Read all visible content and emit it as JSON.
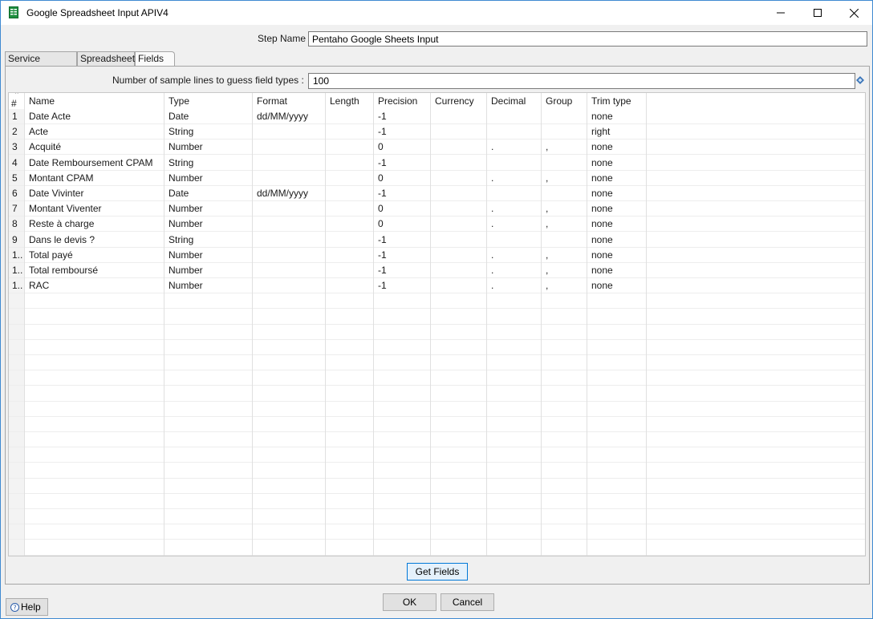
{
  "window": {
    "title": "Google Spreadsheet Input APIV4",
    "app_icon": "spreadsheet-icon",
    "controls": [
      "minimize-icon",
      "maximize-icon",
      "close-icon"
    ]
  },
  "step": {
    "label": "Step Name",
    "value": "Pentaho Google Sheets Input"
  },
  "tabs": [
    {
      "label": "Service Account"
    },
    {
      "label": "Spreadsheet"
    },
    {
      "label": "Fields",
      "active": true
    }
  ],
  "fields_tab": {
    "sample_label": "Number of sample lines to guess field types :",
    "sample_value": "100",
    "variable_icon": "variable-diamond-icon"
  },
  "grid": {
    "columns": [
      "#",
      "Name",
      "Type",
      "Format",
      "Length",
      "Precision",
      "Currency",
      "Decimal",
      "Group",
      "Trim type"
    ],
    "rows": [
      {
        "num": "1",
        "name": "Date Acte",
        "type": "Date",
        "format": "dd/MM/yyyy",
        "length": "",
        "precision": "-1",
        "currency": "",
        "decimal": "",
        "group": "",
        "trim": "none"
      },
      {
        "num": "2",
        "name": "Acte",
        "type": "String",
        "format": "",
        "length": "",
        "precision": "-1",
        "currency": "",
        "decimal": "",
        "group": "",
        "trim": "right"
      },
      {
        "num": "3",
        "name": "Acquité",
        "type": "Number",
        "format": "",
        "length": "",
        "precision": "0",
        "currency": "",
        "decimal": ".",
        "group": ",",
        "trim": "none"
      },
      {
        "num": "4",
        "name": "Date Remboursement CPAM",
        "type": "String",
        "format": "",
        "length": "",
        "precision": "-1",
        "currency": "",
        "decimal": "",
        "group": "",
        "trim": "none"
      },
      {
        "num": "5",
        "name": "Montant CPAM",
        "type": "Number",
        "format": "",
        "length": "",
        "precision": "0",
        "currency": "",
        "decimal": ".",
        "group": ",",
        "trim": "none"
      },
      {
        "num": "6",
        "name": "Date Vivinter",
        "type": "Date",
        "format": "dd/MM/yyyy",
        "length": "",
        "precision": "-1",
        "currency": "",
        "decimal": "",
        "group": "",
        "trim": "none"
      },
      {
        "num": "7",
        "name": "Montant Viventer",
        "type": "Number",
        "format": "",
        "length": "",
        "precision": "0",
        "currency": "",
        "decimal": ".",
        "group": ",",
        "trim": "none"
      },
      {
        "num": "8",
        "name": "Reste à charge",
        "type": "Number",
        "format": "",
        "length": "",
        "precision": "0",
        "currency": "",
        "decimal": ".",
        "group": ",",
        "trim": "none"
      },
      {
        "num": "9",
        "name": "Dans le devis ?",
        "type": "String",
        "format": "",
        "length": "",
        "precision": "-1",
        "currency": "",
        "decimal": "",
        "group": "",
        "trim": "none"
      },
      {
        "num": "1..",
        "name": "Total payé",
        "type": "Number",
        "format": "",
        "length": "",
        "precision": "-1",
        "currency": "",
        "decimal": ".",
        "group": ",",
        "trim": "none"
      },
      {
        "num": "1..",
        "name": "Total remboursé",
        "type": "Number",
        "format": "",
        "length": "",
        "precision": "-1",
        "currency": "",
        "decimal": ".",
        "group": ",",
        "trim": "none"
      },
      {
        "num": "1..",
        "name": "RAC",
        "type": "Number",
        "format": "",
        "length": "",
        "precision": "-1",
        "currency": "",
        "decimal": ".",
        "group": ",",
        "trim": "none"
      }
    ]
  },
  "buttons": {
    "get_fields": "Get Fields",
    "ok": "OK",
    "cancel": "Cancel",
    "help": "Help"
  }
}
